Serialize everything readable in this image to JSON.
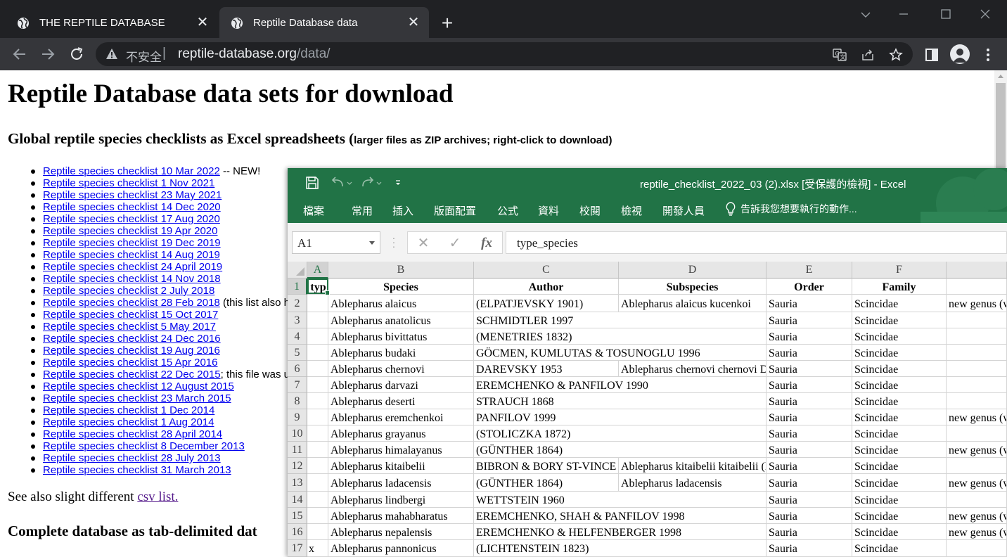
{
  "browser": {
    "tabs": [
      {
        "title": "THE REPTILE DATABASE"
      },
      {
        "title": "Reptile Database data"
      }
    ],
    "address_bar": {
      "security_label": "不安全",
      "url_host": "reptile-database.org",
      "url_path": "/data/"
    }
  },
  "webpage": {
    "heading": "Reptile Database data sets for download",
    "subheading": "Global reptile species checklists as Excel spreadsheets (",
    "subheading_note": "larger files as ZIP archives; right-click to download)",
    "checklist": [
      {
        "link": "Reptile species checklist 10 Mar 2022",
        "note": " -- NEW!"
      },
      {
        "link": "Reptile species checklist 1 Nov 2021",
        "note": ""
      },
      {
        "link": "Reptile species checklist 23 May 2021",
        "note": ""
      },
      {
        "link": "Reptile species checklist 14 Dec 2020",
        "note": ""
      },
      {
        "link": "Reptile species checklist 17 Aug 2020",
        "note": ""
      },
      {
        "link": "Reptile species checklist 19 Apr 2020",
        "note": ""
      },
      {
        "link": "Reptile species checklist 19 Dec 2019",
        "note": ""
      },
      {
        "link": "Reptile species checklist 14 Aug 2019",
        "note": ""
      },
      {
        "link": "Reptile species checklist 24 April 2019",
        "note": ""
      },
      {
        "link": "Reptile species checklist 14 Nov 2018",
        "note": ""
      },
      {
        "link": "Reptile species checklist 2 July 2018",
        "note": ""
      },
      {
        "link": "Reptile species checklist 28 Feb 2018",
        "note": " (this list also h"
      },
      {
        "link": "Reptile species checklist 15 Oct 2017",
        "note": ""
      },
      {
        "link": "Reptile species checklist 5 May 2017",
        "note": ""
      },
      {
        "link": "Reptile species checklist 24 Dec 2016",
        "note": ""
      },
      {
        "link": "Reptile species checklist 19 Aug 2016",
        "note": ""
      },
      {
        "link": "Reptile species checklist 15 Apr 2016",
        "note": ""
      },
      {
        "link": "Reptile species checklist 22 Dec 2015",
        "note": "; this file was u"
      },
      {
        "link": "Reptile species checklist 12 August 2015",
        "note": ""
      },
      {
        "link": "Reptile species checklist 23 March 2015",
        "note": ""
      },
      {
        "link": "Reptile species checklist 1 Dec 2014",
        "note": ""
      },
      {
        "link": "Reptile species checklist 1 Aug 2014",
        "note": ""
      },
      {
        "link": "Reptile species checklist 28 April 2014",
        "note": ""
      },
      {
        "link": "Reptile species checklist 8 December 2013",
        "note": ""
      },
      {
        "link": "Reptile species checklist 28 July 2013",
        "note": ""
      },
      {
        "link": "Reptile species checklist 31 March 2013",
        "note": ""
      }
    ],
    "see_also_text": "See also slight different ",
    "see_also_link": "csv list.",
    "heading3": "Complete database as tab-delimited dat"
  },
  "excel": {
    "document_title": "reptile_checklist_2022_03 (2).xlsx  [受保護的檢視] - Excel",
    "menu": [
      "檔案",
      "常用",
      "插入",
      "版面配置",
      "公式",
      "資料",
      "校閱",
      "檢視",
      "開發人員"
    ],
    "tell_me": "告訴我您想要執行的動作...",
    "name_box": "A1",
    "formula": "type_species",
    "column_letters": [
      "A",
      "B",
      "C",
      "D",
      "E",
      "F",
      ""
    ],
    "row_numbers": [
      "1",
      "2",
      "3",
      "4",
      "5",
      "6",
      "7",
      "8",
      "9",
      "10",
      "11",
      "12",
      "13",
      "14",
      "15",
      "16",
      "17"
    ],
    "rows": [
      [
        "typ",
        "Species",
        "Author",
        "Subspecies",
        "Order",
        "Family",
        ""
      ],
      [
        "",
        "Ablepharus alaicus",
        "(ELPATJEVSKY 1901)",
        "Ablepharus alaicus kucenkoi",
        "Sauria",
        "Scincidae",
        "new genus (w"
      ],
      [
        "",
        "Ablepharus anatolicus",
        "SCHMIDTLER 1997",
        "",
        "Sauria",
        "Scincidae",
        ""
      ],
      [
        "",
        "Ablepharus bivittatus",
        "(MENETRIES 1832)",
        "",
        "Sauria",
        "Scincidae",
        ""
      ],
      [
        "",
        "Ablepharus budaki",
        "GÖCMEN, KUMLUTAS & TOSUNOGLU 1996",
        "",
        "Sauria",
        "Scincidae",
        ""
      ],
      [
        "",
        "Ablepharus chernovi",
        "DAREVSKY 1953",
        "Ablepharus chernovi chernovi D",
        "Sauria",
        "Scincidae",
        ""
      ],
      [
        "",
        "Ablepharus darvazi",
        "EREMCHENKO & PANFILOV 1990",
        "",
        "Sauria",
        "Scincidae",
        ""
      ],
      [
        "",
        "Ablepharus deserti",
        "STRAUCH 1868",
        "",
        "Sauria",
        "Scincidae",
        ""
      ],
      [
        "",
        "Ablepharus eremchenkoi",
        "PANFILOV 1999",
        "",
        "Sauria",
        "Scincidae",
        "new genus (w"
      ],
      [
        "",
        "Ablepharus grayanus",
        "(STOLICZKA 1872)",
        "",
        "Sauria",
        "Scincidae",
        ""
      ],
      [
        "",
        "Ablepharus himalayanus",
        "(GÜNTHER 1864)",
        "",
        "Sauria",
        "Scincidae",
        "new genus (w"
      ],
      [
        "",
        "Ablepharus kitaibelii",
        "BIBRON & BORY ST-VINCE",
        "Ablepharus kitaibelii kitaibelii (B",
        "Sauria",
        "Scincidae",
        ""
      ],
      [
        "",
        "Ablepharus ladacensis",
        "(GÜNTHER 1864)",
        "Ablepharus ladacensis",
        "Sauria",
        "Scincidae",
        "new genus (w"
      ],
      [
        "",
        "Ablepharus lindbergi",
        "WETTSTEIN 1960",
        "",
        "Sauria",
        "Scincidae",
        ""
      ],
      [
        "",
        "Ablepharus mahabharatus",
        "EREMCHENKO, SHAH & PANFILOV 1998",
        "",
        "Sauria",
        "Scincidae",
        "new genus (w"
      ],
      [
        "",
        "Ablepharus nepalensis",
        "EREMCHENKO & HELFENBERGER 1998",
        "",
        "Sauria",
        "Scincidae",
        "new genus (w"
      ],
      [
        "x",
        "Ablepharus pannonicus",
        "(LICHTENSTEIN 1823)",
        "",
        "Sauria",
        "Scincidae",
        ""
      ]
    ]
  },
  "colors": {
    "excel_green": "#217346",
    "chrome_dark": "#202124",
    "chrome_toolbar": "#35363a",
    "link_blue": "#0000ee",
    "link_visited": "#551a8b"
  }
}
